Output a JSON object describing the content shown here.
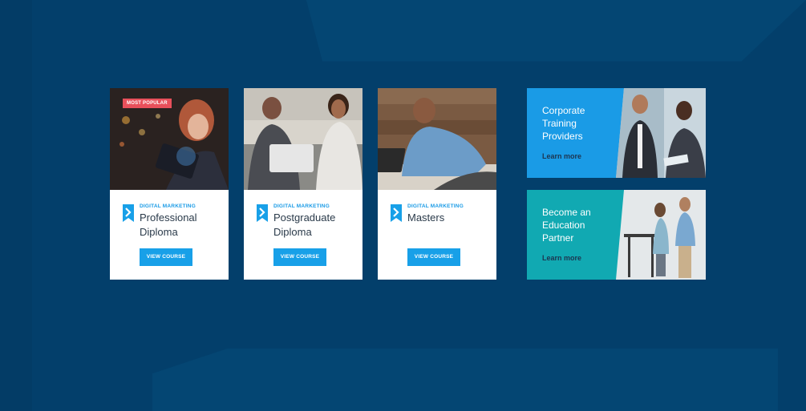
{
  "courses": [
    {
      "badge": "MOST POPULAR",
      "category": "DIGITAL MARKETING",
      "title": "Professional Diploma",
      "button": "VIEW COURSE"
    },
    {
      "category": "DIGITAL MARKETING",
      "title": "Postgraduate Diploma",
      "button": "VIEW COURSE"
    },
    {
      "category": "DIGITAL MARKETING",
      "title": "Masters",
      "button": "VIEW COURSE"
    }
  ],
  "promos": [
    {
      "title": "Corporate Training Providers",
      "link": "Learn more",
      "color": "#1a9be6"
    },
    {
      "title": "Become an Education Partner",
      "link": "Learn more",
      "color": "#11a9b2"
    }
  ],
  "colors": {
    "background": "#033f6b",
    "accent": "#18a0e8",
    "badge": "#e8505b"
  }
}
